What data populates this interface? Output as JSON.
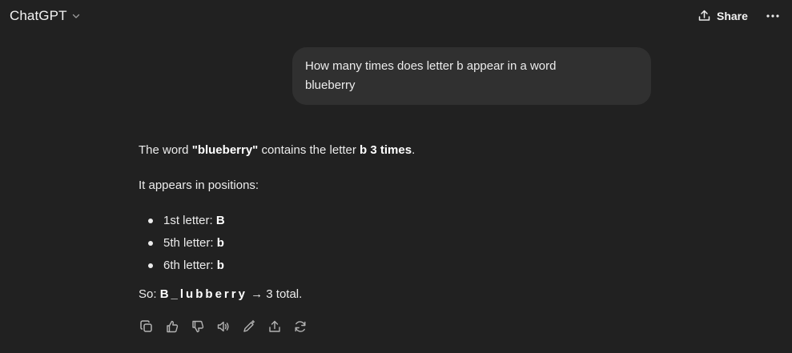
{
  "header": {
    "model_name": "ChatGPT",
    "share_label": "Share"
  },
  "user_message": {
    "line1": "How many times does letter b appear in a word",
    "line2": "blueberry"
  },
  "answer": {
    "p1_prefix": "The word ",
    "p1_word": "\"blueberry\"",
    "p1_mid": " contains the letter ",
    "p1_bold": "b 3 times",
    "p1_end": ".",
    "p2": "It appears in positions:",
    "list": [
      {
        "label": "1st letter: ",
        "value": "B"
      },
      {
        "label": "5th letter: ",
        "value": "b"
      },
      {
        "label": "6th letter: ",
        "value": "b"
      }
    ],
    "so_label": "So: ",
    "sequence": [
      "B",
      "_",
      "l",
      "u",
      "b",
      "b",
      "e",
      "r",
      "r",
      "y"
    ],
    "arrow": " → ",
    "total": "3 total."
  },
  "actions": [
    "copy-icon",
    "thumbs-up-icon",
    "thumbs-down-icon",
    "read-aloud-icon",
    "edit-icon",
    "share-icon",
    "regenerate-icon"
  ],
  "colors": {
    "background": "#212121",
    "bubble": "#303030",
    "text": "#ececec",
    "icon": "#b4b4b4"
  }
}
